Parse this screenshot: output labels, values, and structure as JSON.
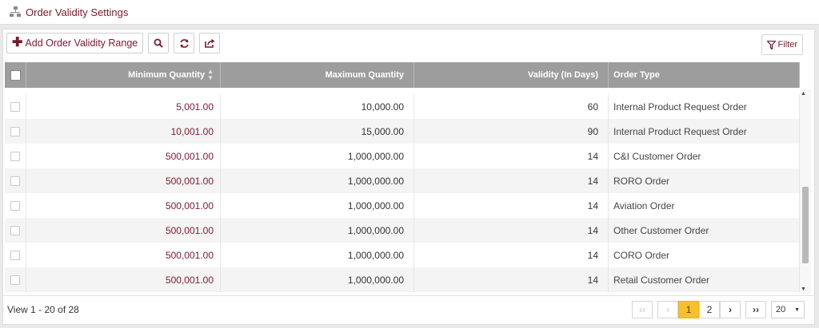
{
  "page": {
    "title": "Order Validity Settings"
  },
  "toolbar": {
    "add_label": "Add Order Validity Range",
    "search_icon": "search-icon",
    "refresh_icon": "refresh-icon",
    "export_icon": "export-icon",
    "filter_label": "Filter"
  },
  "table": {
    "columns": [
      "Minimum Quantity",
      "Maximum Quantity",
      "Validity (In Days)",
      "Order Type"
    ],
    "sort": {
      "column": "Minimum Quantity",
      "direction": "both"
    },
    "rows": [
      {
        "min": "5,001.00",
        "max": "10,000.00",
        "validity": "60",
        "type": "Internal Product Request Order"
      },
      {
        "min": "10,001.00",
        "max": "15,000.00",
        "validity": "90",
        "type": "Internal Product Request Order"
      },
      {
        "min": "500,001.00",
        "max": "1,000,000.00",
        "validity": "14",
        "type": "C&I Customer Order"
      },
      {
        "min": "500,001.00",
        "max": "1,000,000.00",
        "validity": "14",
        "type": "RORO Order"
      },
      {
        "min": "500,001.00",
        "max": "1,000,000.00",
        "validity": "14",
        "type": "Aviation Order"
      },
      {
        "min": "500,001.00",
        "max": "1,000,000.00",
        "validity": "14",
        "type": "Other Customer Order"
      },
      {
        "min": "500,001.00",
        "max": "1,000,000.00",
        "validity": "14",
        "type": "CORO Order"
      },
      {
        "min": "500,001.00",
        "max": "1,000,000.00",
        "validity": "14",
        "type": "Retail Customer Order"
      }
    ]
  },
  "footer": {
    "view_info": "View 1 - 20 of 28",
    "pages": [
      "1",
      "2"
    ],
    "current_page": "1",
    "page_size": "20"
  },
  "colors": {
    "accent": "#7b1a2e",
    "header_bg": "#9d9d9d",
    "active_page": "#f7c12b"
  }
}
